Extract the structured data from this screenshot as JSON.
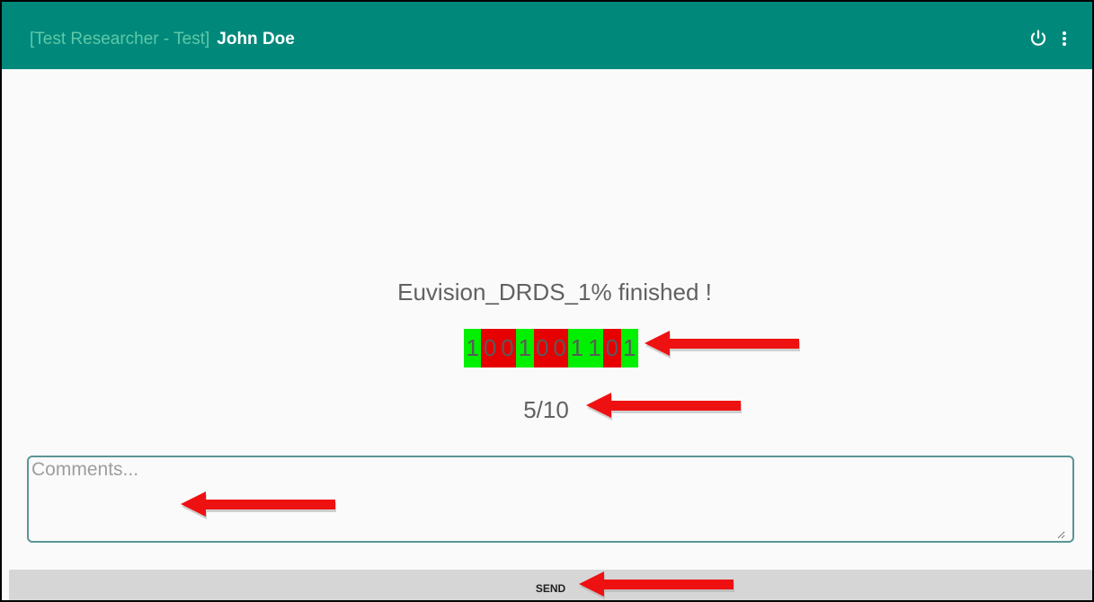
{
  "app_bar": {
    "title_prefix": "[Test Researcher  - Test]",
    "user_name": "John Doe",
    "color": "#00897b",
    "actions": [
      {
        "name": "power-icon"
      },
      {
        "name": "more-vert-icon"
      }
    ]
  },
  "result": {
    "message": "Euvision_DRDS_1% finished !",
    "sequence": [
      {
        "digit": "1",
        "status": "correct"
      },
      {
        "digit": "0",
        "status": "wrong"
      },
      {
        "digit": "0",
        "status": "wrong"
      },
      {
        "digit": "1",
        "status": "correct"
      },
      {
        "digit": "0",
        "status": "wrong"
      },
      {
        "digit": "0",
        "status": "wrong"
      },
      {
        "digit": "1",
        "status": "correct"
      },
      {
        "digit": "1",
        "status": "correct"
      },
      {
        "digit": "0",
        "status": "wrong"
      },
      {
        "digit": "1",
        "status": "correct"
      }
    ],
    "score": "5/10"
  },
  "comments": {
    "placeholder": "Comments...",
    "value": ""
  },
  "send": {
    "label": "SEND"
  },
  "colors": {
    "correct": "#00f000",
    "wrong": "#e60000",
    "annotation_arrow": "#ee1111",
    "field_border": "#5a9594"
  }
}
